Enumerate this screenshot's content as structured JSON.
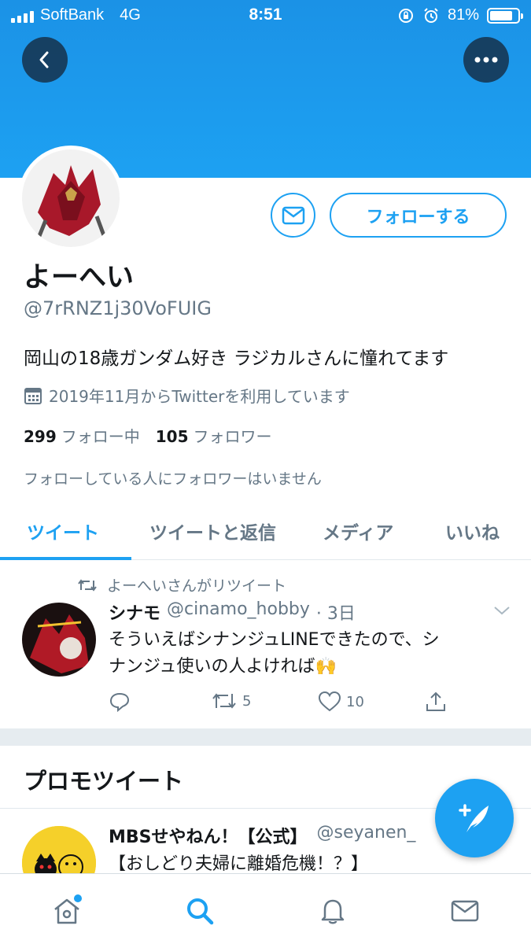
{
  "status_bar": {
    "carrier": "SoftBank",
    "network": "4G",
    "time": "8:51",
    "battery_percent": "81%",
    "battery_level": 0.81
  },
  "header": {
    "back_icon": "chevron-left-icon",
    "more_icon": "ellipsis-icon"
  },
  "profile": {
    "display_name": "よーへい",
    "handle": "@7rRNZ1j30VoFUIG",
    "bio": "岡山の18歳ガンダム好き ラジカルさんに憧れてます",
    "joined": "2019年11月からTwitterを利用しています",
    "following_count": "299",
    "following_label": "フォロー中",
    "followers_count": "105",
    "followers_label": "フォロワー",
    "no_mutual_followers": "フォローしている人にフォロワーはいません",
    "follow_button": "フォローする"
  },
  "tabs": [
    {
      "label": "ツイート",
      "active": true
    },
    {
      "label": "ツイートと返信",
      "active": false
    },
    {
      "label": "メディア",
      "active": false
    },
    {
      "label": "いいね",
      "active": false
    }
  ],
  "tweet": {
    "retweeted_by": "よーへいさんがリツイート",
    "author_name": "シナモ",
    "author_handle": "@cinamo_hobby",
    "time": "· 3日",
    "text_line1": "そういえばシナンジュLINEできたので、シ",
    "text_line2": "ナンジュ使いの人よければ🙌",
    "retweets": "5",
    "likes": "10"
  },
  "promo": {
    "section_title": "プロモツイート",
    "author_name": "MBSせやねん！【公式】",
    "author_handle": "@seyanen_",
    "text": "【おしどり夫婦に離婚危機！？】"
  },
  "colors": {
    "accent": "#1da1f2",
    "header_bg": "#1da1f2",
    "muted": "#657786"
  }
}
